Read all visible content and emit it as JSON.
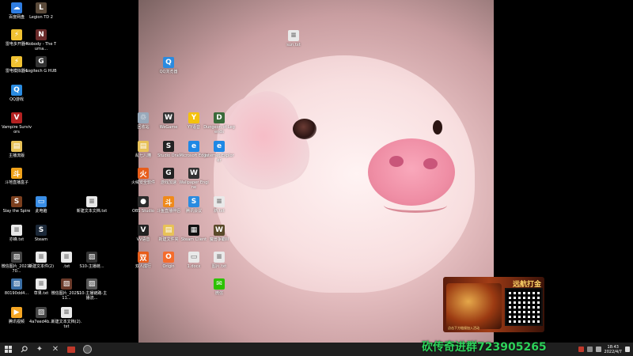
{
  "desktop_icons": [
    {
      "label": "百度网盘",
      "color": "#2f7de1",
      "glyph": "☁",
      "icon_name": "baidu-netdisk-icon"
    },
    {
      "label": "Legion TD 2",
      "color": "#5a4a3a",
      "glyph": "L",
      "icon_name": "legion-td2-icon"
    },
    {
      "label": "雷电多开器4",
      "color": "#f1c232",
      "glyph": "⚡",
      "icon_name": "ld-multiplayer-icon"
    },
    {
      "label": "Nobody - The Turna...",
      "color": "#6a2b2b",
      "glyph": "N",
      "icon_name": "nobody-game-icon"
    },
    {
      "label": "雷电模拟器4",
      "color": "#f1c232",
      "glyph": "⚡",
      "icon_name": "ld-player-icon"
    },
    {
      "label": "Logitech G HUB",
      "color": "#333",
      "glyph": "G",
      "icon_name": "logitech-ghub-icon"
    },
    {
      "label": "QQ游戏",
      "color": "#2a8be0",
      "glyph": "Q",
      "icon_name": "qq-game-icon"
    },
    {
      "label": "Vampire Survivors",
      "color": "#b32121",
      "glyph": "V",
      "icon_name": "vampire-survivors-icon"
    },
    {
      "label": "主播流版",
      "color": "#e8c258",
      "glyph": "▤",
      "icon_name": "folder-icon"
    },
    {
      "label": "斗地直播盒子",
      "color": "#f0a21a",
      "glyph": "斗",
      "icon_name": "douyu-box-icon"
    },
    {
      "label": "Slay the Spire",
      "color": "#7b3f1e",
      "glyph": "S",
      "icon_name": "slay-the-spire-icon"
    },
    {
      "label": "此电脑",
      "color": "#3a8ee6",
      "glyph": "▭",
      "icon_name": "this-pc-icon"
    },
    {
      "label": "新建文本文档.txt",
      "color": "#e9e9e9",
      "glyph": "≡",
      "icon_name": "text-file-icon"
    },
    {
      "label": "亦峰.txt",
      "color": "#e9e9e9",
      "glyph": "≡",
      "icon_name": "text-file-icon"
    },
    {
      "label": "Steam",
      "color": "#1b2838",
      "glyph": "S",
      "icon_name": "steam-icon"
    },
    {
      "label": "微信图片_2021070...",
      "color": "#444",
      "glyph": "▨",
      "icon_name": "image-file-icon"
    },
    {
      "label": "新建文本件(2)",
      "color": "#e9e9e9",
      "glyph": "≡",
      "icon_name": "text-file-icon"
    },
    {
      "label": ".txt",
      "color": "#e9e9e9",
      "glyph": "≡",
      "icon_name": "text-file-icon"
    },
    {
      "label": "S10-主播链...",
      "color": "#333",
      "glyph": "▨",
      "icon_name": "image-file-icon"
    },
    {
      "label": "80190dd4...",
      "color": "#3a6ea5",
      "glyph": "▨",
      "icon_name": "image-file-icon"
    },
    {
      "label": "草果.txt",
      "color": "#e9e9e9",
      "glyph": "≡",
      "icon_name": "text-file-icon"
    },
    {
      "label": "微信图片_2021111...",
      "color": "#6a3a2a",
      "glyph": "▨",
      "icon_name": "image-file-icon"
    },
    {
      "label": "S10-主播链路-主播流...",
      "color": "#555",
      "glyph": "▨",
      "icon_name": "image-file-icon"
    },
    {
      "label": "腾讯视频",
      "color": "#f5a623",
      "glyph": "▶",
      "icon_name": "tencent-video-icon"
    },
    {
      "label": "4a7eed4b...",
      "color": "#444",
      "glyph": "▨",
      "icon_name": "image-file-icon"
    },
    {
      "label": "新建文本文档(2).txt",
      "color": "#e9e9e9",
      "glyph": "≡",
      "icon_name": "text-file-icon"
    },
    {
      "label": "QQ浏览器",
      "color": "#2a8be0",
      "glyph": "Q",
      "icon_name": "qq-browser-icon"
    },
    {
      "label": "sun.txt",
      "color": "#e9e9e9",
      "glyph": "≡",
      "icon_name": "text-file-icon"
    },
    {
      "label": "回收站",
      "color": "#9ab",
      "glyph": "♲",
      "icon_name": "recycle-bin-icon"
    },
    {
      "label": "WeGame",
      "color": "#333",
      "glyph": "W",
      "icon_name": "wegame-icon"
    },
    {
      "label": "YY语音",
      "color": "#f4c20d",
      "glyph": "Y",
      "icon_name": "yy-icon"
    },
    {
      "label": "Dungeon of Legends",
      "color": "#3a6b3a",
      "glyph": "D",
      "icon_name": "dungeon-legends-icon"
    },
    {
      "label": "乱七八糟",
      "color": "#e8c258",
      "glyph": "▤",
      "icon_name": "folder-icon"
    },
    {
      "label": "Studio One",
      "color": "#222",
      "glyph": "S",
      "icon_name": "studio-one-icon"
    },
    {
      "label": "Microsoft Edge",
      "color": "#1e88e5",
      "glyph": "e",
      "icon_name": "edge-icon"
    },
    {
      "label": "Internet Explorer",
      "color": "#1e88e5",
      "glyph": "e",
      "icon_name": "ie-icon"
    },
    {
      "label": "火绒安全软件",
      "color": "#e85d1a",
      "glyph": "火",
      "icon_name": "huorong-icon"
    },
    {
      "label": "游戏加速",
      "color": "#222",
      "glyph": "G",
      "icon_name": "game-boost-icon"
    },
    {
      "label": "Wallpaper Engine",
      "color": "#333",
      "glyph": "W",
      "icon_name": "wallpaper-engine-icon"
    },
    {
      "label": "OBS Studio",
      "color": "#2b2b2b",
      "glyph": "●",
      "icon_name": "obs-icon"
    },
    {
      "label": "斗鱼直播伴侣",
      "color": "#f08a1a",
      "glyph": "斗",
      "icon_name": "douyu-companion-icon"
    },
    {
      "label": "腾讯会议",
      "color": "#2a8be0",
      "glyph": "S",
      "icon_name": "tencent-meeting-icon"
    },
    {
      "label": "新.txt",
      "color": "#e9e9e9",
      "glyph": "≡",
      "icon_name": "text-file-icon"
    },
    {
      "label": "VV语音",
      "color": "#222",
      "glyph": "V",
      "icon_name": "vv-voice-icon"
    },
    {
      "label": "新建文件夹",
      "color": "#e8c258",
      "glyph": "▤",
      "icon_name": "folder-icon"
    },
    {
      "label": "Steam Client",
      "color": "#111",
      "glyph": "▦",
      "icon_name": "qr-app-icon"
    },
    {
      "label": "魔兽争霸III",
      "color": "#5a4a2a",
      "glyph": "W",
      "icon_name": "warcraft-icon"
    },
    {
      "label": "双人成行",
      "color": "#e85d1a",
      "glyph": "双",
      "icon_name": "it-takes-two-icon"
    },
    {
      "label": "Origin",
      "color": "#f56c2d",
      "glyph": "O",
      "icon_name": "origin-icon"
    },
    {
      "label": "1.docx",
      "color": "#e9e9e9",
      "glyph": "▭",
      "icon_name": "doc-file-icon"
    },
    {
      "label": "图片.txt",
      "color": "#e9e9e9",
      "glyph": "≡",
      "icon_name": "text-file-icon"
    },
    {
      "label": "微信",
      "color": "#2dc100",
      "glyph": "✉",
      "icon_name": "wechat-icon"
    }
  ],
  "taskbar": {
    "start_icon": "windows-start-icon",
    "search_icon": "search-icon",
    "clock_time": "18:43",
    "clock_date": "2022/4/7"
  },
  "promo": {
    "title": "远航打金",
    "caption": "点击下方链接加入活动"
  },
  "overlay_text": "砍传奇进群723905265"
}
